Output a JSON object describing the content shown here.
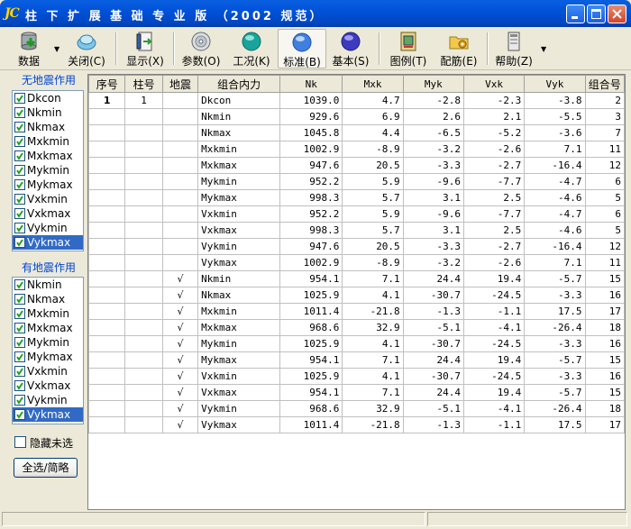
{
  "window": {
    "logo": "JC",
    "title": "柱 下 扩 展 基 础 专 业 版 （2002 规范）"
  },
  "toolbar": {
    "data": "数据",
    "close": "关闭(C)",
    "display": "显示(X)",
    "params": "参数(O)",
    "cases": "工况(K)",
    "standard": "标准(B)",
    "basic": "基本(S)",
    "legend": "图例(T)",
    "rebar": "配筋(E)",
    "help": "帮助(Z)"
  },
  "left_panel": {
    "no_quake_title": "无地震作用",
    "no_quake_items": [
      "Dkcon",
      "Nkmin",
      "Nkmax",
      "Mxkmin",
      "Mxkmax",
      "Mykmin",
      "Mykmax",
      "Vxkmin",
      "Vxkmax",
      "Vykmin",
      "Vykmax"
    ],
    "quake_title": "有地震作用",
    "quake_items": [
      "Nkmin",
      "Nkmax",
      "Mxkmin",
      "Mxkmax",
      "Mykmin",
      "Mykmax",
      "Vxkmin",
      "Vxkmax",
      "Vykmin",
      "Vykmax"
    ],
    "hide_unselected": "隐藏未选",
    "select_all": "全选/简略"
  },
  "table": {
    "headers": [
      "序号",
      "柱号",
      "地震",
      "组合内力",
      "Nk",
      "Mxk",
      "Myk",
      "Vxk",
      "Vyk",
      "组合号"
    ],
    "rows": [
      [
        "1",
        "1",
        "",
        "Dkcon",
        "1039.0",
        "4.7",
        "-2.8",
        "-2.3",
        "-3.8",
        "2"
      ],
      [
        "",
        "",
        "",
        "Nkmin",
        "929.6",
        "6.9",
        "2.6",
        "2.1",
        "-5.5",
        "3"
      ],
      [
        "",
        "",
        "",
        "Nkmax",
        "1045.8",
        "4.4",
        "-6.5",
        "-5.2",
        "-3.6",
        "7"
      ],
      [
        "",
        "",
        "",
        "Mxkmin",
        "1002.9",
        "-8.9",
        "-3.2",
        "-2.6",
        "7.1",
        "11"
      ],
      [
        "",
        "",
        "",
        "Mxkmax",
        "947.6",
        "20.5",
        "-3.3",
        "-2.7",
        "-16.4",
        "12"
      ],
      [
        "",
        "",
        "",
        "Mykmin",
        "952.2",
        "5.9",
        "-9.6",
        "-7.7",
        "-4.7",
        "6"
      ],
      [
        "",
        "",
        "",
        "Mykmax",
        "998.3",
        "5.7",
        "3.1",
        "2.5",
        "-4.6",
        "5"
      ],
      [
        "",
        "",
        "",
        "Vxkmin",
        "952.2",
        "5.9",
        "-9.6",
        "-7.7",
        "-4.7",
        "6"
      ],
      [
        "",
        "",
        "",
        "Vxkmax",
        "998.3",
        "5.7",
        "3.1",
        "2.5",
        "-4.6",
        "5"
      ],
      [
        "",
        "",
        "",
        "Vykmin",
        "947.6",
        "20.5",
        "-3.3",
        "-2.7",
        "-16.4",
        "12"
      ],
      [
        "",
        "",
        "",
        "Vykmax",
        "1002.9",
        "-8.9",
        "-3.2",
        "-2.6",
        "7.1",
        "11"
      ],
      [
        "",
        "",
        "√",
        "Nkmin",
        "954.1",
        "7.1",
        "24.4",
        "19.4",
        "-5.7",
        "15"
      ],
      [
        "",
        "",
        "√",
        "Nkmax",
        "1025.9",
        "4.1",
        "-30.7",
        "-24.5",
        "-3.3",
        "16"
      ],
      [
        "",
        "",
        "√",
        "Mxkmin",
        "1011.4",
        "-21.8",
        "-1.3",
        "-1.1",
        "17.5",
        "17"
      ],
      [
        "",
        "",
        "√",
        "Mxkmax",
        "968.6",
        "32.9",
        "-5.1",
        "-4.1",
        "-26.4",
        "18"
      ],
      [
        "",
        "",
        "√",
        "Mykmin",
        "1025.9",
        "4.1",
        "-30.7",
        "-24.5",
        "-3.3",
        "16"
      ],
      [
        "",
        "",
        "√",
        "Mykmax",
        "954.1",
        "7.1",
        "24.4",
        "19.4",
        "-5.7",
        "15"
      ],
      [
        "",
        "",
        "√",
        "Vxkmin",
        "1025.9",
        "4.1",
        "-30.7",
        "-24.5",
        "-3.3",
        "16"
      ],
      [
        "",
        "",
        "√",
        "Vxkmax",
        "954.1",
        "7.1",
        "24.4",
        "19.4",
        "-5.7",
        "15"
      ],
      [
        "",
        "",
        "√",
        "Vykmin",
        "968.6",
        "32.9",
        "-5.1",
        "-4.1",
        "-26.4",
        "18"
      ],
      [
        "",
        "",
        "√",
        "Vykmax",
        "1011.4",
        "-21.8",
        "-1.3",
        "-1.1",
        "17.5",
        "17"
      ]
    ]
  }
}
